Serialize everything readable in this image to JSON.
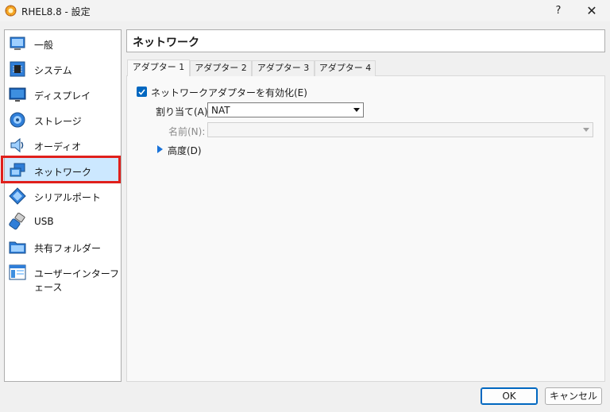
{
  "window": {
    "title": "RHEL8.8 - 設定",
    "help": "?",
    "close": "✕"
  },
  "sidebar": {
    "items": [
      {
        "label": "一般",
        "icon": "general-icon"
      },
      {
        "label": "システム",
        "icon": "system-icon"
      },
      {
        "label": "ディスプレイ",
        "icon": "display-icon"
      },
      {
        "label": "ストレージ",
        "icon": "storage-icon"
      },
      {
        "label": "オーディオ",
        "icon": "audio-icon"
      },
      {
        "label": "ネットワーク",
        "icon": "network-icon",
        "selected": true
      },
      {
        "label": "シリアルポート",
        "icon": "serial-port-icon"
      },
      {
        "label": "USB",
        "icon": "usb-icon"
      },
      {
        "label": "共有フォルダー",
        "icon": "shared-folder-icon"
      },
      {
        "label": "ユーザーインターフェース",
        "icon": "user-interface-icon"
      }
    ]
  },
  "main": {
    "page_title": "ネットワーク",
    "tabs": [
      {
        "label": "アダプター 1",
        "active": true
      },
      {
        "label": "アダプター 2"
      },
      {
        "label": "アダプター 3"
      },
      {
        "label": "アダプター 4"
      }
    ],
    "enable_adapter": {
      "label": "ネットワークアダプターを有効化(E)",
      "checked": true
    },
    "attached_to": {
      "label": "割り当て(A):",
      "value": "NAT"
    },
    "name": {
      "label": "名前(N):",
      "value": ""
    },
    "advanced": {
      "label": "高度(D)"
    }
  },
  "buttons": {
    "ok": "OK",
    "cancel": "キャンセル"
  },
  "colors": {
    "accent": "#0067c0",
    "selected_bg": "#cce8ff",
    "highlight": "#e0201c"
  }
}
